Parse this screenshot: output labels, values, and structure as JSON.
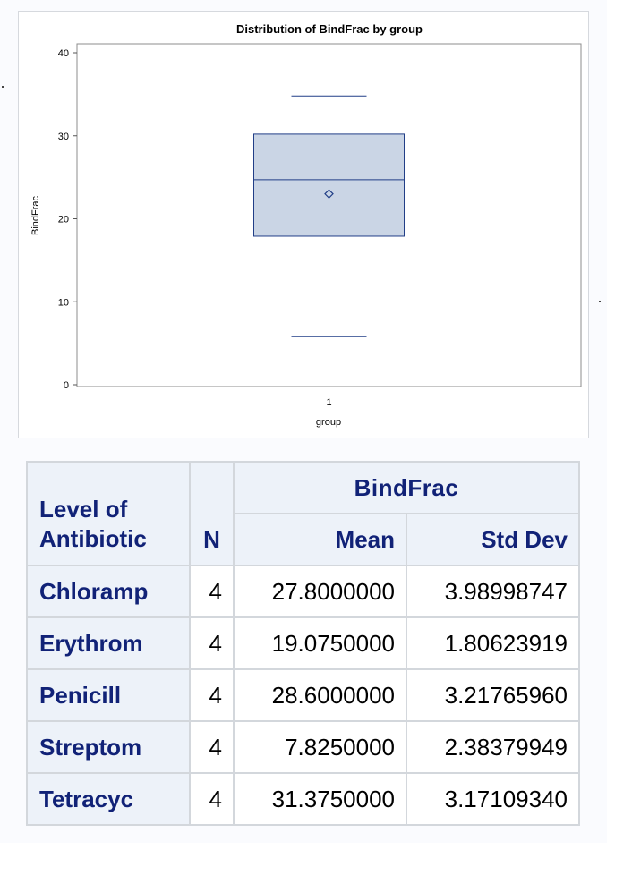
{
  "chart_data": {
    "type": "box",
    "title": "Distribution of BindFrac by group",
    "xlabel": "group",
    "ylabel": "BindFrac",
    "categories": [
      "1"
    ],
    "ylim": [
      0,
      40
    ],
    "yticks": [
      0,
      10,
      20,
      30,
      40
    ],
    "boxes": [
      {
        "category": "1",
        "min": 5.8,
        "q1": 17.9,
        "median": 24.7,
        "q3": 30.2,
        "max": 34.8,
        "mean": 23.0
      }
    ],
    "colors": {
      "box_fill": "#cad5e5",
      "line": "#213e87"
    }
  },
  "table": {
    "header": {
      "rowlabel": [
        "Level of",
        "Antibiotic"
      ],
      "n": "N",
      "group": "BindFrac",
      "mean": "Mean",
      "std": "Std Dev"
    },
    "rows": [
      {
        "level": "Chloramp",
        "n": "4",
        "mean": "27.8000000",
        "std": "3.98998747"
      },
      {
        "level": "Erythrom",
        "n": "4",
        "mean": "19.0750000",
        "std": "1.80623919"
      },
      {
        "level": "Penicill",
        "n": "4",
        "mean": "28.6000000",
        "std": "3.21765960"
      },
      {
        "level": "Streptom",
        "n": "4",
        "mean": "7.8250000",
        "std": "2.38379949"
      },
      {
        "level": "Tetracyc",
        "n": "4",
        "mean": "31.3750000",
        "std": "3.17109340"
      }
    ]
  }
}
